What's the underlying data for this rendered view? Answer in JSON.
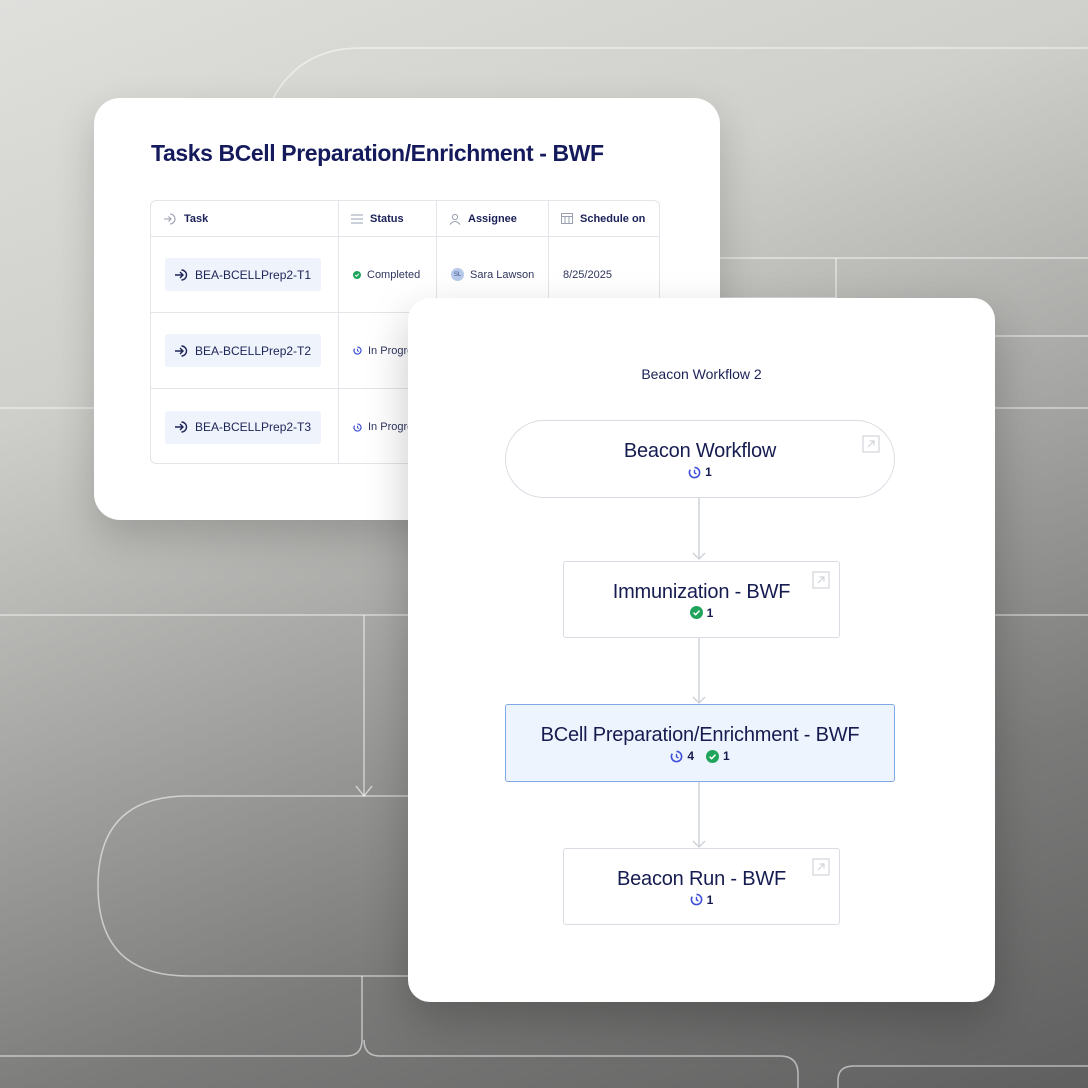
{
  "tasks": {
    "title": "Tasks BCell Preparation/Enrichment - BWF",
    "columns": {
      "task": "Task",
      "status": "Status",
      "assignee": "Assignee",
      "schedule": "Schedule on"
    },
    "rows": [
      {
        "task": "BEA-BCELLPrep2-T1",
        "status": "Completed",
        "assignee_initials": "SL",
        "assignee": "Sara Lawson",
        "schedule": "8/25/2025"
      },
      {
        "task": "BEA-BCELLPrep2-T2",
        "status": "In Progres"
      },
      {
        "task": "BEA-BCELLPrep2-T3",
        "status": "In Progres"
      }
    ]
  },
  "workflow": {
    "title": "Beacon Workflow 2",
    "nodes": [
      {
        "label": "Beacon Workflow",
        "in_progress": "1"
      },
      {
        "label": "Immunization - BWF",
        "completed": "1"
      },
      {
        "label": "BCell Preparation/Enrichment - BWF",
        "in_progress": "4",
        "completed": "1"
      },
      {
        "label": "Beacon Run - BWF",
        "in_progress": "1"
      }
    ]
  },
  "colors": {
    "title_navy": "#141a5b",
    "completed_green": "#1fa45c",
    "in_progress_blue": "#3f50d8",
    "highlight_fill": "#eef4fd",
    "highlight_border": "#7ea8e6"
  },
  "icons": [
    "task-enter-icon",
    "status-list-icon",
    "assignee-user-icon",
    "calendar-icon",
    "in-progress-icon",
    "completed-check-icon",
    "open-external-icon"
  ]
}
